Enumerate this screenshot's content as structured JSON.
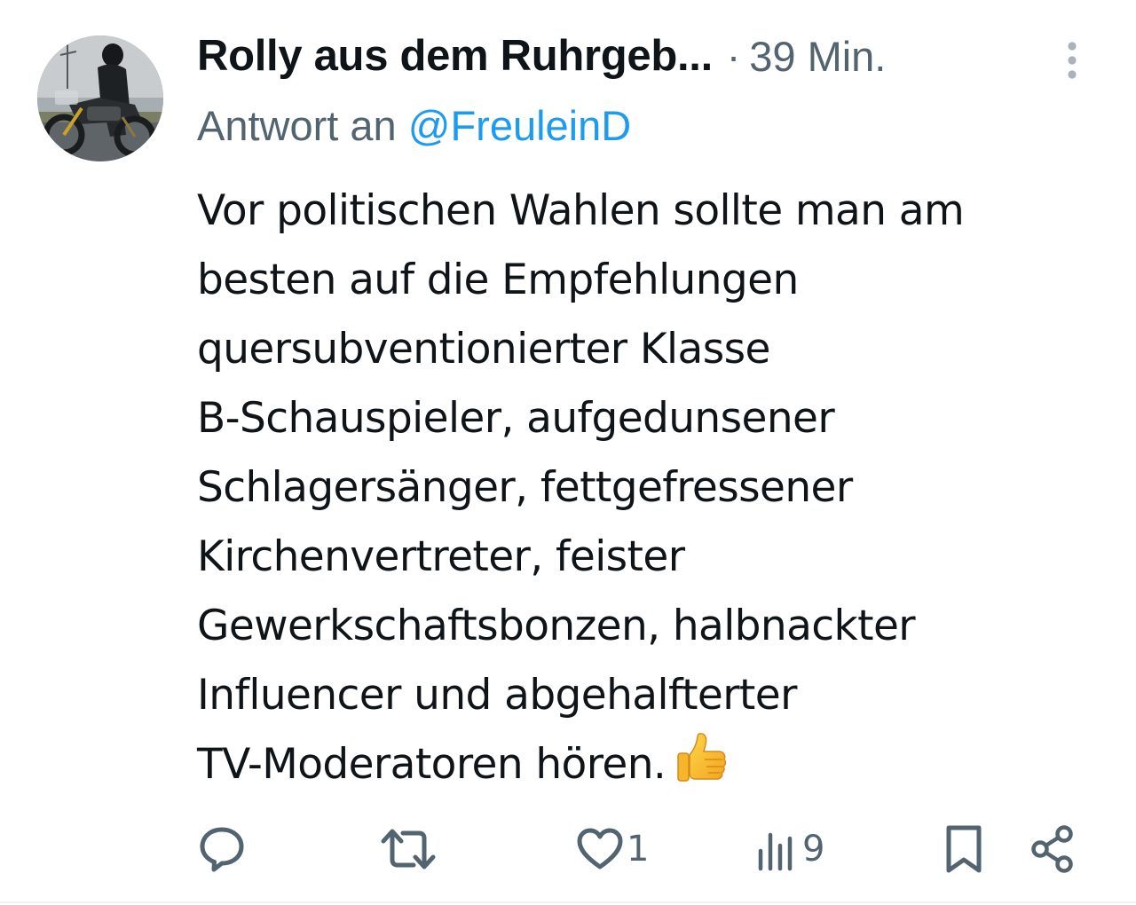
{
  "tweet": {
    "author": {
      "display_name": "Rolly aus dem Ruhrgeb...",
      "avatar_icon": "motorcycle-rider-avatar"
    },
    "separator": "·",
    "time": "39 Min.",
    "reply_prefix": "Antwort an",
    "reply_handle": "@FreuleinD",
    "text_lines": [
      "Vor politischen Wahlen sollte man am",
      "besten auf die Empfehlungen",
      "quersubventionierter Klasse",
      "B-Schauspieler, aufgedunsener",
      "Schlagersänger, fettgefressener",
      "Kirchenvertreter, feister",
      "Gewerkschaftsbonzen, halbnackter",
      "Influencer und abgehalfterter",
      "TV-Moderatoren hören."
    ],
    "emoji": "thumbs-up-emoji"
  },
  "actions": {
    "reply": {
      "icon": "reply-bubble-icon"
    },
    "retweet": {
      "icon": "retweet-icon"
    },
    "like": {
      "icon": "heart-icon",
      "count": "1"
    },
    "views": {
      "icon": "views-bar-chart-icon",
      "count": "9"
    },
    "bookmark": {
      "icon": "bookmark-icon"
    },
    "share": {
      "icon": "share-icon"
    }
  },
  "colors": {
    "text_primary": "#0f1419",
    "text_secondary": "#536471",
    "link": "#1d9bf0",
    "icon": "#536471"
  }
}
